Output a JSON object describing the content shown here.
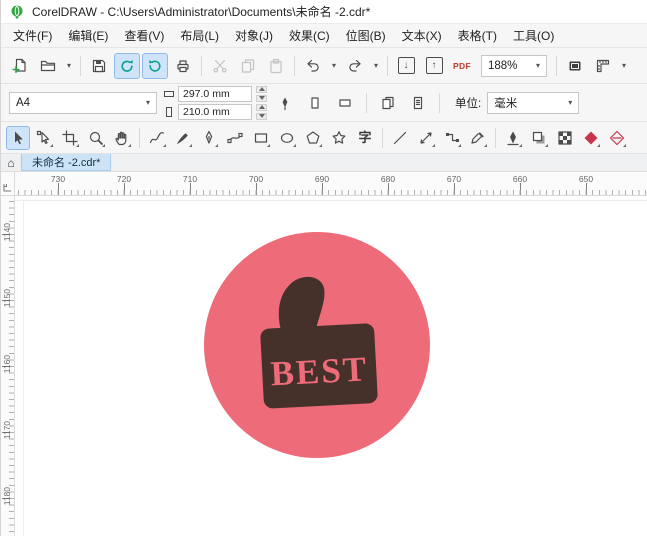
{
  "window": {
    "title": "CorelDRAW - C:\\Users\\Administrator\\Documents\\未命名 -2.cdr*"
  },
  "menubar": {
    "items": [
      {
        "label": "文件(F)"
      },
      {
        "label": "编辑(E)"
      },
      {
        "label": "查看(V)"
      },
      {
        "label": "布局(L)"
      },
      {
        "label": "对象(J)"
      },
      {
        "label": "效果(C)"
      },
      {
        "label": "位图(B)"
      },
      {
        "label": "文本(X)"
      },
      {
        "label": "表格(T)"
      },
      {
        "label": "工具(O)"
      }
    ]
  },
  "glyphs": {
    "caret": "▾",
    "arrow_down": "↓",
    "arrow_up": "↑",
    "home": "⌂",
    "text_tool": "字"
  },
  "toolbar": {
    "zoom_level": "188%",
    "pdf_label": "PDF"
  },
  "property_bar": {
    "page_size": "A4",
    "page_width": "297.0 mm",
    "page_height": "210.0 mm",
    "units_label": "单位:",
    "units_value": "毫米"
  },
  "document_tabs": {
    "active_tab": "未命名 -2.cdr*"
  },
  "rulers": {
    "horizontal": [
      "730",
      "720",
      "710",
      "700",
      "690",
      "680",
      "670",
      "660",
      "650"
    ],
    "vertical": [
      "1140",
      "1150",
      "1160",
      "1170",
      "1180"
    ]
  },
  "canvas": {
    "badge": {
      "text": "BEST",
      "circle_color": "#ee6b79",
      "thumb_color": "#46312a",
      "text_color": "#ee6b79"
    }
  }
}
